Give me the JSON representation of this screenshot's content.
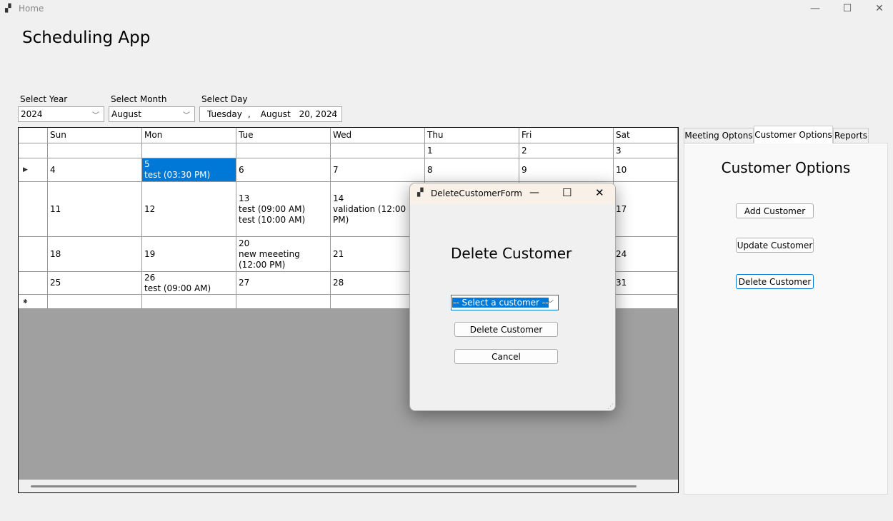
{
  "window": {
    "title": "Home",
    "app_icon": "app-icon",
    "minimize": "—",
    "maximize": "☐",
    "close": "✕"
  },
  "header": {
    "title": "Scheduling App"
  },
  "filters": {
    "year": {
      "label": "Select Year",
      "value": "2024"
    },
    "month": {
      "label": "Select Month",
      "value": "August"
    },
    "day": {
      "label": "Select Day",
      "weekday": "Tuesday",
      "sep": ",",
      "month": "August",
      "date": "20, 2024"
    }
  },
  "calendar": {
    "columns": [
      "Sun",
      "Mon",
      "Tue",
      "Wed",
      "Thu",
      "Fri",
      "Sat"
    ],
    "rows": [
      [
        "",
        "",
        "",
        "",
        "1",
        "2",
        "3"
      ],
      [
        "4",
        "5\ntest (03:30 PM)",
        "6",
        "7",
        "8",
        "9",
        "10"
      ],
      [
        "11",
        "12",
        "13\ntest (09:00 AM)\ntest (10:00 AM)",
        "14\nvalidation (12:00 PM)",
        "",
        "",
        "17"
      ],
      [
        "18",
        "19",
        "20\nnew meeeting (12:00 PM)",
        "21",
        "",
        "",
        "24"
      ],
      [
        "25",
        "26\ntest (09:00 AM)",
        "27",
        "28",
        "",
        "",
        "31"
      ],
      [
        "",
        "",
        "",
        "",
        "",
        "",
        ""
      ]
    ],
    "selected_cell": "5",
    "current_row_marker": "▶",
    "new_row_marker": "✱",
    "selection_color": "#0078d7"
  },
  "tabs": [
    {
      "label": "Meeting Optons"
    },
    {
      "label": "Customer Options",
      "active": true
    },
    {
      "label": "Reports"
    }
  ],
  "customer_panel": {
    "title": "Customer Options",
    "add": "Add Customer",
    "update": "Update Customer",
    "delete": "Delete Customer"
  },
  "dialog": {
    "title": "DeleteCustomerForm",
    "heading": "Delete Customer",
    "select_value": "-- Select a customer --",
    "delete_button": "Delete Customer",
    "cancel_button": "Cancel"
  }
}
